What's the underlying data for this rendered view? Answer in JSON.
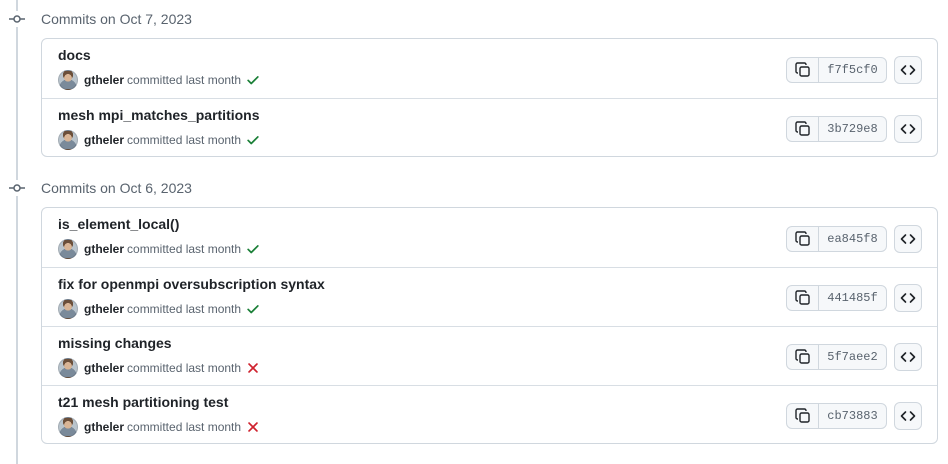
{
  "groups": [
    {
      "title": "Commits on Oct 7, 2023",
      "commits": [
        {
          "message": "docs",
          "author": "gtheler",
          "committed_text": "committed last month",
          "status": "success",
          "sha": "f7f5cf0"
        },
        {
          "message": "mesh mpi_matches_partitions",
          "author": "gtheler",
          "committed_text": "committed last month",
          "status": "success",
          "sha": "3b729e8"
        }
      ]
    },
    {
      "title": "Commits on Oct 6, 2023",
      "commits": [
        {
          "message": "is_element_local()",
          "author": "gtheler",
          "committed_text": "committed last month",
          "status": "success",
          "sha": "ea845f8"
        },
        {
          "message": "fix for openmpi oversubscription syntax",
          "author": "gtheler",
          "committed_text": "committed last month",
          "status": "success",
          "sha": "441485f"
        },
        {
          "message": "missing changes",
          "author": "gtheler",
          "committed_text": "committed last month",
          "status": "failure",
          "sha": "5f7aee2"
        },
        {
          "message": "t21 mesh partitioning test",
          "author": "gtheler",
          "committed_text": "committed last month",
          "status": "failure",
          "sha": "cb73883"
        }
      ]
    }
  ],
  "icons": {
    "group_marker": "git-commit-icon",
    "success": "check-icon",
    "failure": "x-icon",
    "copy": "copy-icon",
    "browse": "code-icon"
  },
  "colors": {
    "success": "#1a7f37",
    "failure": "#cf222e",
    "border": "#d0d7de",
    "muted_text": "#59636e"
  }
}
